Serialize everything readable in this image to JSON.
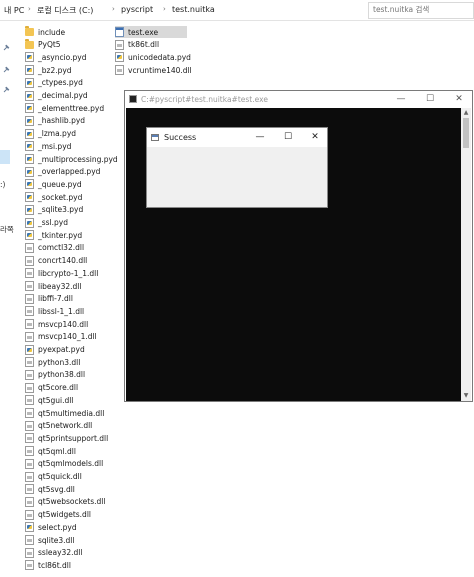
{
  "address_bar": {
    "crumbs": [
      "내 PC",
      "로컬 디스크 (C:)",
      "pyscript",
      "test.nuitka"
    ],
    "search_placeholder": "test.nuitka 검색"
  },
  "nav_pane": {
    "labels": [
      ":)",
      "라쪽"
    ]
  },
  "file_list": {
    "column1": [
      {
        "name": "include",
        "type": "folder"
      },
      {
        "name": "PyQt5",
        "type": "folder"
      },
      {
        "name": "_asyncio.pyd",
        "type": "pyd"
      },
      {
        "name": "_bz2.pyd",
        "type": "pyd"
      },
      {
        "name": "_ctypes.pyd",
        "type": "pyd"
      },
      {
        "name": "_decimal.pyd",
        "type": "pyd"
      },
      {
        "name": "_elementtree.pyd",
        "type": "pyd"
      },
      {
        "name": "_hashlib.pyd",
        "type": "pyd"
      },
      {
        "name": "_lzma.pyd",
        "type": "pyd"
      },
      {
        "name": "_msi.pyd",
        "type": "pyd"
      },
      {
        "name": "_multiprocessing.pyd",
        "type": "pyd"
      },
      {
        "name": "_overlapped.pyd",
        "type": "pyd"
      },
      {
        "name": "_queue.pyd",
        "type": "pyd"
      },
      {
        "name": "_socket.pyd",
        "type": "pyd"
      },
      {
        "name": "_sqlite3.pyd",
        "type": "pyd"
      },
      {
        "name": "_ssl.pyd",
        "type": "pyd"
      },
      {
        "name": "_tkinter.pyd",
        "type": "pyd"
      },
      {
        "name": "comctl32.dll",
        "type": "dll"
      },
      {
        "name": "concrt140.dll",
        "type": "dll"
      },
      {
        "name": "libcrypto-1_1.dll",
        "type": "dll"
      },
      {
        "name": "libeay32.dll",
        "type": "dll"
      },
      {
        "name": "libffi-7.dll",
        "type": "dll"
      },
      {
        "name": "libssl-1_1.dll",
        "type": "dll"
      },
      {
        "name": "msvcp140.dll",
        "type": "dll"
      },
      {
        "name": "msvcp140_1.dll",
        "type": "dll"
      },
      {
        "name": "pyexpat.pyd",
        "type": "pyd"
      },
      {
        "name": "python3.dll",
        "type": "dll"
      },
      {
        "name": "python38.dll",
        "type": "dll"
      },
      {
        "name": "qt5core.dll",
        "type": "dll"
      },
      {
        "name": "qt5gui.dll",
        "type": "dll"
      },
      {
        "name": "qt5multimedia.dll",
        "type": "dll"
      },
      {
        "name": "qt5network.dll",
        "type": "dll"
      },
      {
        "name": "qt5printsupport.dll",
        "type": "dll"
      },
      {
        "name": "qt5qml.dll",
        "type": "dll"
      },
      {
        "name": "qt5qmlmodels.dll",
        "type": "dll"
      },
      {
        "name": "qt5quick.dll",
        "type": "dll"
      },
      {
        "name": "qt5svg.dll",
        "type": "dll"
      },
      {
        "name": "qt5websockets.dll",
        "type": "dll"
      },
      {
        "name": "qt5widgets.dll",
        "type": "dll"
      },
      {
        "name": "select.pyd",
        "type": "pyd"
      },
      {
        "name": "sqlite3.dll",
        "type": "dll"
      },
      {
        "name": "ssleay32.dll",
        "type": "dll"
      },
      {
        "name": "tcl86t.dll",
        "type": "dll"
      }
    ],
    "column2": [
      {
        "name": "test.exe",
        "type": "exe",
        "selected": true
      },
      {
        "name": "tk86t.dll",
        "type": "dll"
      },
      {
        "name": "unicodedata.pyd",
        "type": "pyd"
      },
      {
        "name": "vcruntime140.dll",
        "type": "dll"
      }
    ]
  },
  "console_window": {
    "title": "C:#pyscript#test.nuitka#test.exe",
    "minimize_glyph": "—",
    "maximize_glyph": "☐",
    "close_glyph": "✕",
    "background": "#0c0c0c"
  },
  "dialog": {
    "title": "Success",
    "minimize_glyph": "—",
    "maximize_glyph": "☐",
    "close_glyph": "✕"
  }
}
